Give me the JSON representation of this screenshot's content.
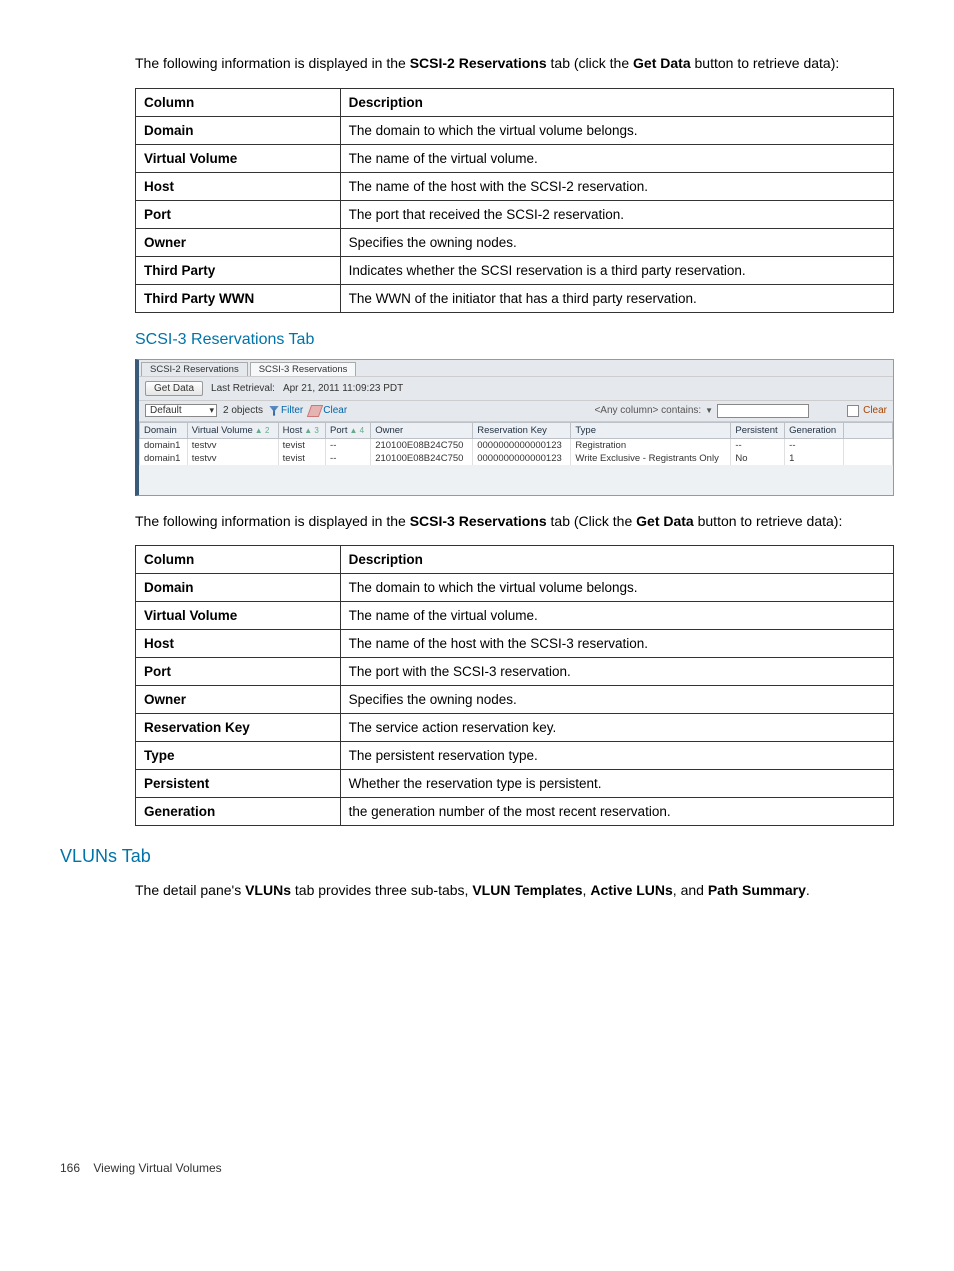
{
  "intro1_prefix": "The following information is displayed in the ",
  "intro1_bold1": "SCSI-2 Reservations",
  "intro1_mid": " tab (click the ",
  "intro1_bold2": "Get Data",
  "intro1_suffix": " button to retrieve data):",
  "t1": {
    "h_col": "Column",
    "h_desc": "Description",
    "rows": [
      {
        "c": "Domain",
        "d": "The domain to which the virtual volume belongs."
      },
      {
        "c": "Virtual Volume",
        "d": "The name of the virtual volume."
      },
      {
        "c": "Host",
        "d": "The name of the host with the SCSI-2 reservation."
      },
      {
        "c": "Port",
        "d": "The port that received the SCSI-2 reservation."
      },
      {
        "c": "Owner",
        "d": "Specifies the owning nodes."
      },
      {
        "c": "Third Party",
        "d": "Indicates whether the SCSI reservation is a third party reservation."
      },
      {
        "c": "Third Party WWN",
        "d": "The WWN of the initiator that has a third party reservation."
      }
    ]
  },
  "subhead_scsi3": "SCSI-3 Reservations Tab",
  "inset": {
    "tab1": "SCSI-2 Reservations",
    "tab2": "SCSI-3 Reservations",
    "get_data": "Get Data",
    "last_retrieval_label": "Last Retrieval:",
    "last_retrieval_value": "Apr 21, 2011 11:09:23 PDT",
    "domain_sel": "Default",
    "objcount": "2 objects",
    "filter": "Filter",
    "clear": "Clear",
    "anycol": "<Any column> contains:",
    "clear2": "Clear",
    "cols": {
      "domain": "Domain",
      "vv": "Virtual Volume",
      "host": "Host",
      "port": "Port",
      "owner": "Owner",
      "rkey": "Reservation Key",
      "type": "Type",
      "persistent": "Persistent",
      "generation": "Generation"
    },
    "sort": {
      "vv": "▲ 2",
      "host": "▲ 3",
      "port": "▲ 4"
    },
    "rows": [
      {
        "domain": "domain1",
        "vv": "testvv",
        "host": "tevist",
        "port": "--",
        "owner": "210100E08B24C750",
        "rkey": "0000000000000123",
        "type": "Registration",
        "persistent": "--",
        "generation": "--"
      },
      {
        "domain": "domain1",
        "vv": "testvv",
        "host": "tevist",
        "port": "--",
        "owner": "210100E08B24C750",
        "rkey": "0000000000000123",
        "type": "Write Exclusive - Registrants Only",
        "persistent": "No",
        "generation": "1"
      }
    ]
  },
  "intro2_prefix": "The following information is displayed in the ",
  "intro2_bold1": "SCSI-3 Reservations",
  "intro2_mid": " tab (Click the ",
  "intro2_bold2": "Get Data",
  "intro2_suffix": " button to retrieve data):",
  "t2": {
    "h_col": "Column",
    "h_desc": "Description",
    "rows": [
      {
        "c": "Domain",
        "d": "The domain to which the virtual volume belongs."
      },
      {
        "c": "Virtual Volume",
        "d": "The name of the virtual volume."
      },
      {
        "c": "Host",
        "d": "The name of the host with the SCSI-3 reservation."
      },
      {
        "c": "Port",
        "d": "The port with the SCSI-3 reservation."
      },
      {
        "c": "Owner",
        "d": "Specifies the owning nodes."
      },
      {
        "c": "Reservation Key",
        "d": "The service action reservation key."
      },
      {
        "c": "Type",
        "d": "The persistent reservation type."
      },
      {
        "c": "Persistent",
        "d": "Whether the reservation type is persistent."
      },
      {
        "c": "Generation",
        "d": "the generation number of the most recent reservation."
      }
    ]
  },
  "vluns_head": "VLUNs Tab",
  "vluns_p_prefix": "The detail pane's ",
  "vluns_b1": "VLUNs",
  "vluns_p_mid1": " tab provides three sub-tabs, ",
  "vluns_b2": "VLUN Templates",
  "vluns_p_mid2": ", ",
  "vluns_b3": "Active LUNs",
  "vluns_p_mid3": ", and ",
  "vluns_b4": "Path Summary",
  "vluns_p_suffix": ".",
  "footer_page": "166",
  "footer_text": "Viewing Virtual Volumes"
}
